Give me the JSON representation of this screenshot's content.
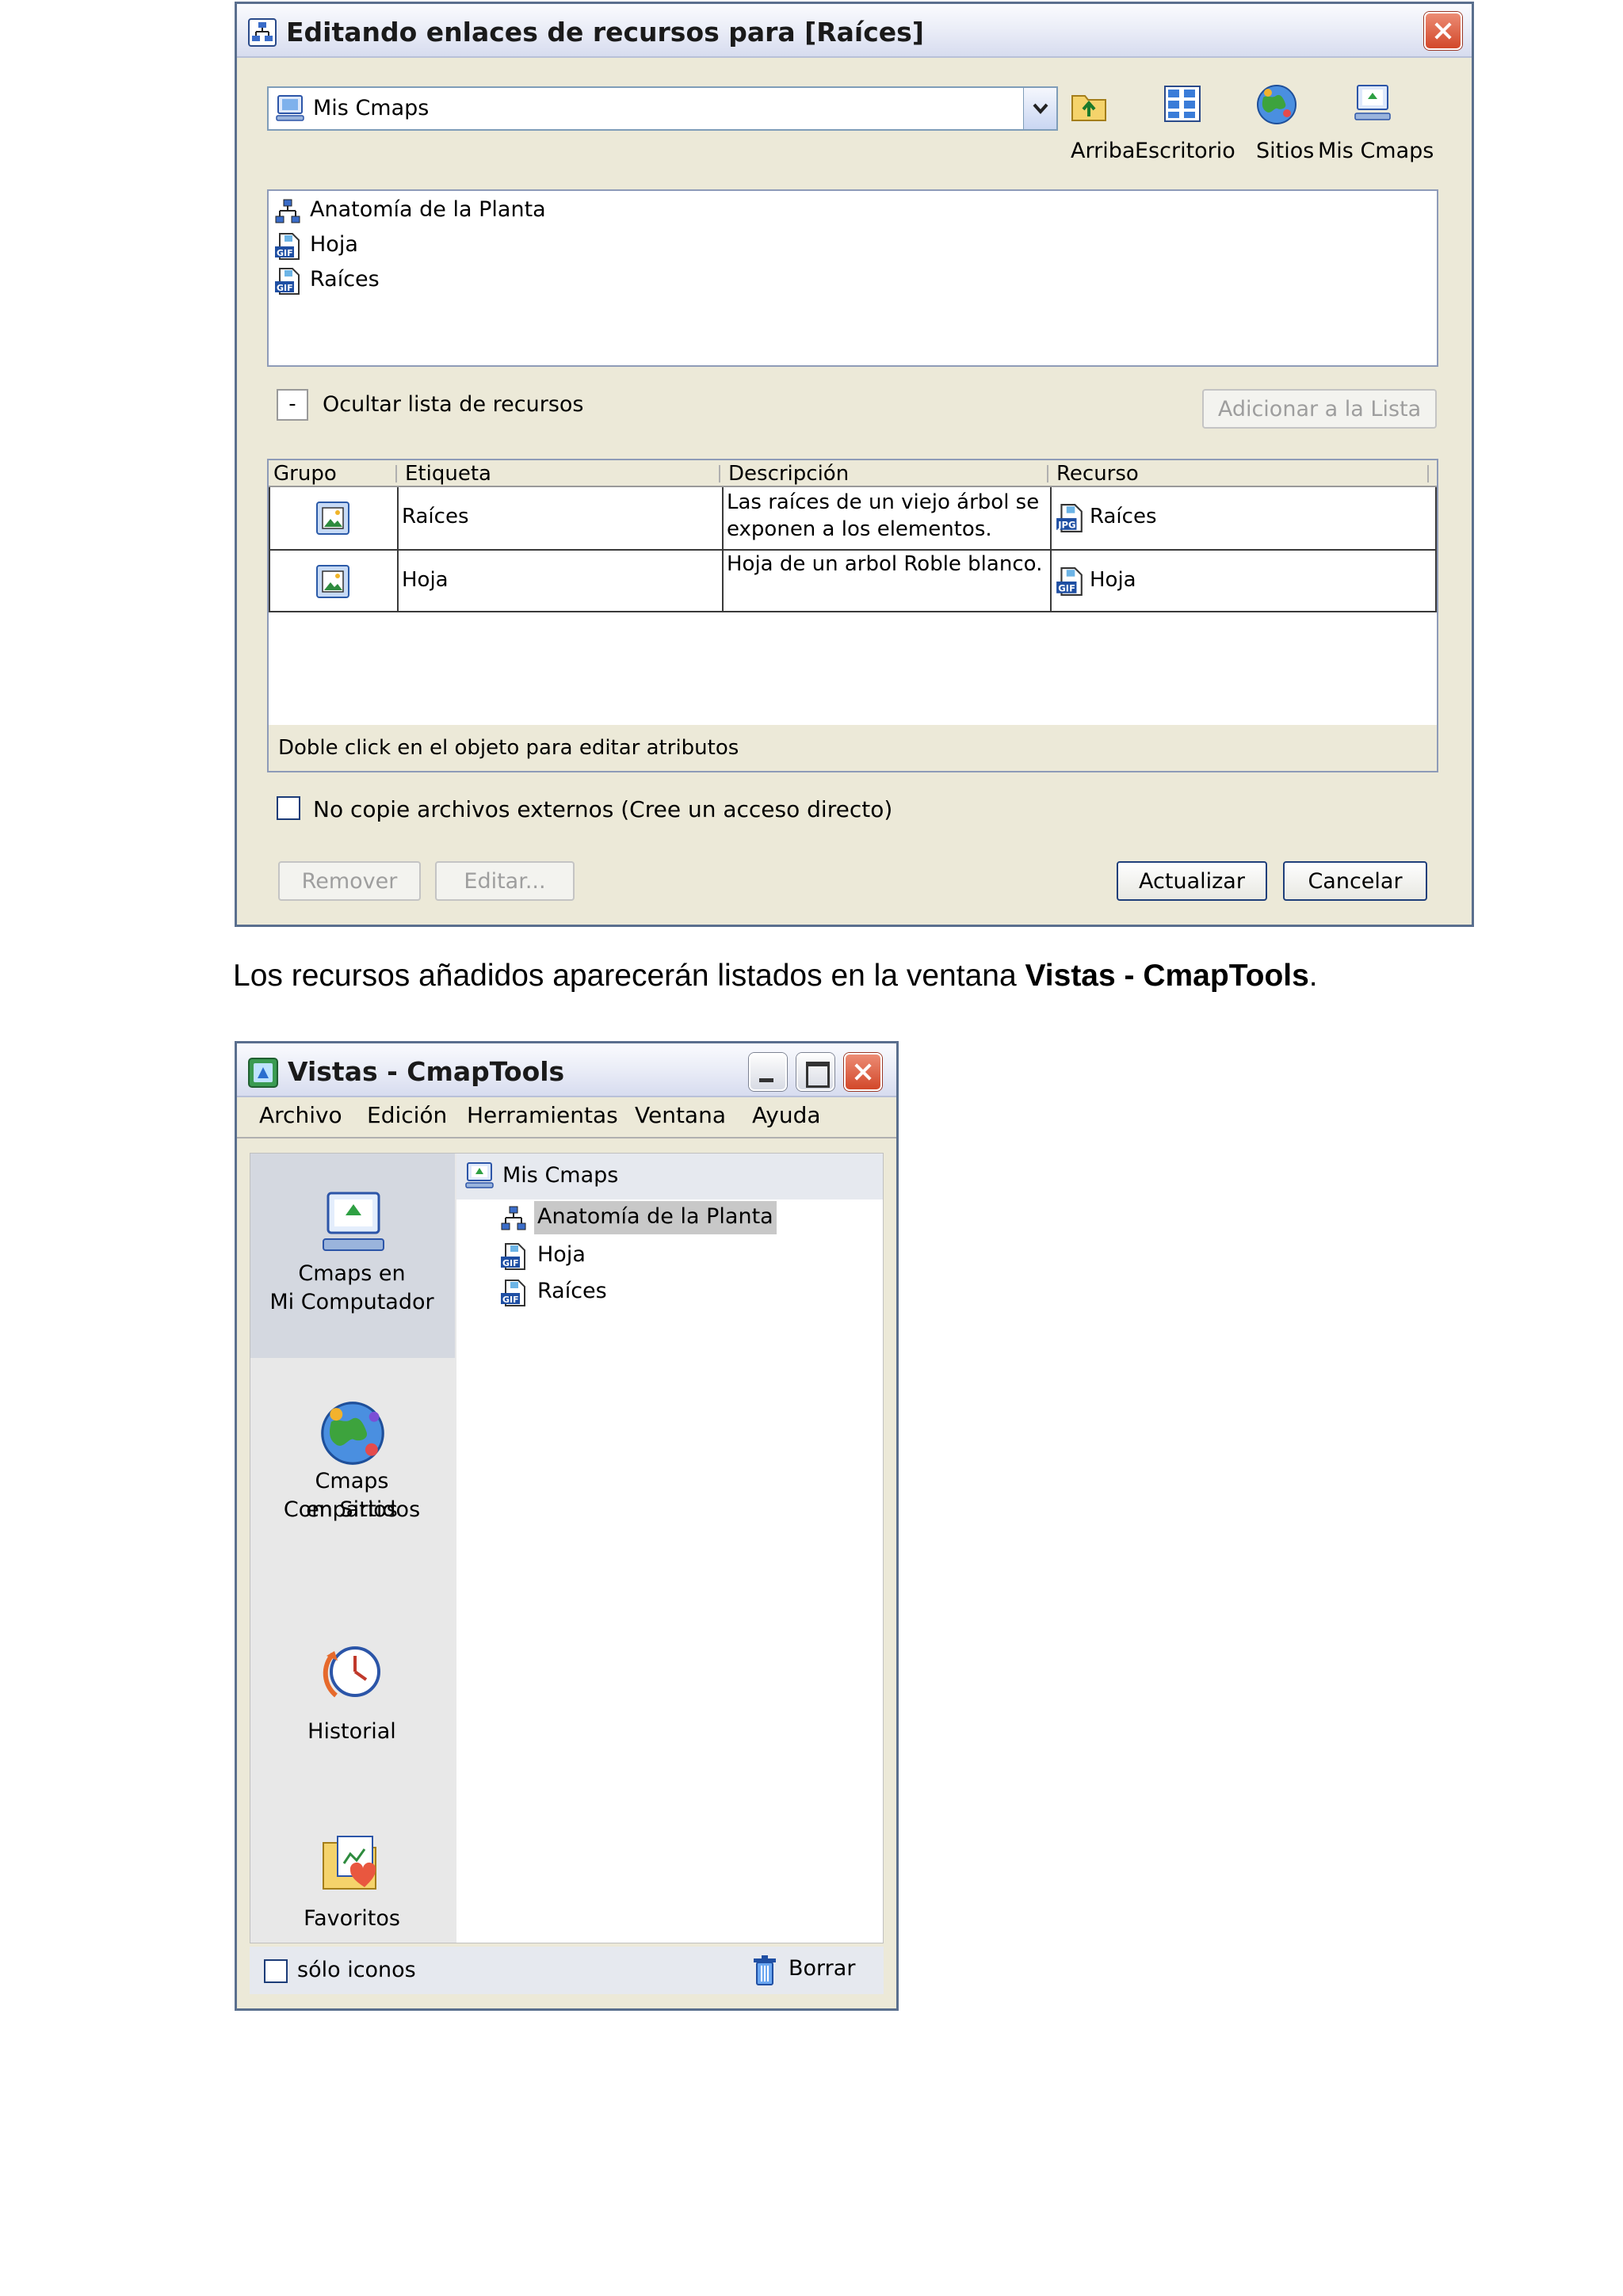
{
  "dialog": {
    "title": "Editando enlaces de recursos para [Raíces]",
    "location_value": "Mis Cmaps",
    "toolbar": {
      "up_label": "Arriba",
      "desktop_label": "Escritorio",
      "sites_label": "Sitios",
      "mycmaps_label": "Mis Cmaps"
    },
    "resources": [
      {
        "label": "Anatomía de la Planta",
        "icon": "cmap-icon"
      },
      {
        "label": "Hoja",
        "icon": "gif-file-icon"
      },
      {
        "label": "Raíces",
        "icon": "gif-file-icon"
      }
    ],
    "hide_list_toggle": "-",
    "hide_list_label": "Ocultar lista de recursos",
    "add_button": "Adicionar a la Lista",
    "table": {
      "headers": [
        "Grupo",
        "Etiqueta",
        "Descripción",
        "Recurso"
      ],
      "rows": [
        {
          "label": "Raíces",
          "desc_line1": "Las raíces de un viejo árbol se",
          "desc_line2": "exponen a los elementos.",
          "resource": "Raíces",
          "resource_icon": "jpg-file-icon"
        },
        {
          "label": "Hoja",
          "desc_line1": "Hoja de un arbol Roble blanco.",
          "desc_line2": "",
          "resource": "Hoja",
          "resource_icon": "gif-file-icon"
        }
      ],
      "status": "Doble click en el objeto para editar atributos"
    },
    "no_copy_label": "No copie archivos externos (Cree un acceso directo)",
    "remove_button": "Remover",
    "edit_button": "Editar...",
    "update_button": "Actualizar",
    "cancel_button": "Cancelar"
  },
  "caption": {
    "prefix": "Los recursos añadidos aparecerán listados en la ventana ",
    "bold": "Vistas - CmapTools",
    "suffix": "."
  },
  "views": {
    "title": "Vistas - CmapTools",
    "menu": [
      "Archivo",
      "Edición",
      "Herramientas",
      "Ventana",
      "Ayuda"
    ],
    "nav": [
      {
        "line1": "Cmaps en",
        "line2": "Mi Computador"
      },
      {
        "line1": "Cmaps Compartidos",
        "line2": "en Sitios"
      },
      {
        "line1": "Historial",
        "line2": ""
      },
      {
        "line1": "Favoritos",
        "line2": ""
      }
    ],
    "tree_root": "Mis Cmaps",
    "tree_items": [
      "Anatomía de la Planta",
      "Hoja",
      "Raíces"
    ],
    "icons_only_label": "sólo iconos",
    "delete_label": "Borrar"
  },
  "colors": {
    "window_border": "#5a6f8e",
    "dialog_bg": "#ece9d8",
    "selection": "#c8c8c8",
    "close_button": "#d2482a"
  }
}
